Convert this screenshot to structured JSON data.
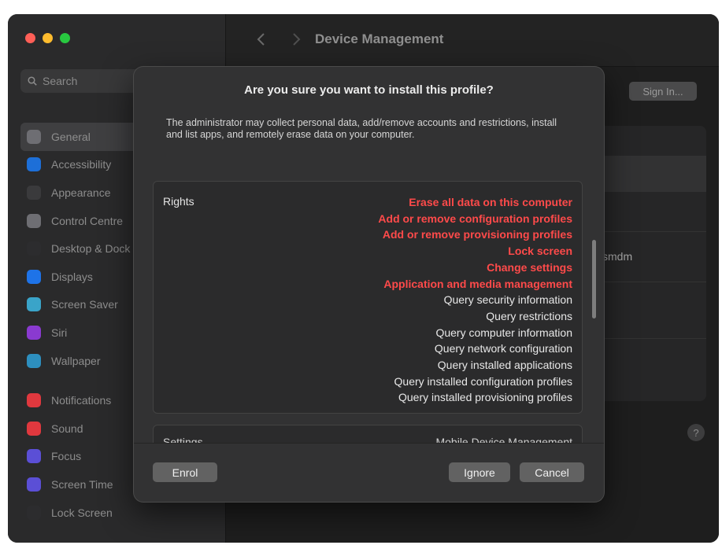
{
  "window": {
    "title": "Device Management",
    "sign_in_label": "Sign In...",
    "mdm_text": "smdm",
    "help_label": "?"
  },
  "sidebar": {
    "search_placeholder": "Search",
    "items": [
      {
        "label": "General",
        "icon": "gear-icon",
        "color": "#6e6e73",
        "active": true
      },
      {
        "label": "Accessibility",
        "icon": "accessibility-icon",
        "color": "#1d6fd8"
      },
      {
        "label": "Appearance",
        "icon": "appearance-icon",
        "color": "#3a3a3c"
      },
      {
        "label": "Control Centre",
        "icon": "control-centre-icon",
        "color": "#6e6e73"
      },
      {
        "label": "Desktop & Dock",
        "icon": "desktop-dock-icon",
        "color": "#2c2c2e"
      },
      {
        "label": "Displays",
        "icon": "displays-icon",
        "color": "#1e73e8"
      },
      {
        "label": "Screen Saver",
        "icon": "screen-saver-icon",
        "color": "#3aa4c9"
      },
      {
        "label": "Siri",
        "icon": "siri-icon",
        "color": "#8a3ad0"
      },
      {
        "label": "Wallpaper",
        "icon": "wallpaper-icon",
        "color": "#2d8fbf"
      },
      {
        "label": "Notifications",
        "icon": "notifications-icon",
        "color": "#e0383e"
      },
      {
        "label": "Sound",
        "icon": "sound-icon",
        "color": "#e0383e"
      },
      {
        "label": "Focus",
        "icon": "focus-icon",
        "color": "#5b4fd6"
      },
      {
        "label": "Screen Time",
        "icon": "screen-time-icon",
        "color": "#5b4fd6"
      },
      {
        "label": "Lock Screen",
        "icon": "lock-screen-icon",
        "color": "#2c2c2e"
      }
    ]
  },
  "dialog": {
    "title": "Are you sure you want to install this profile?",
    "message": "The administrator may collect personal data, add/remove accounts and restrictions, install and list apps, and remotely erase data on your computer.",
    "rights_label": "Rights",
    "rights": [
      {
        "text": "Erase all data on this computer",
        "danger": true
      },
      {
        "text": "Add or remove configuration profiles",
        "danger": true
      },
      {
        "text": "Add or remove provisioning profiles",
        "danger": true
      },
      {
        "text": "Lock screen",
        "danger": true
      },
      {
        "text": "Change settings",
        "danger": true
      },
      {
        "text": "Application and media management",
        "danger": true
      },
      {
        "text": "Query security information",
        "danger": false
      },
      {
        "text": "Query restrictions",
        "danger": false
      },
      {
        "text": "Query computer information",
        "danger": false
      },
      {
        "text": "Query network configuration",
        "danger": false
      },
      {
        "text": "Query installed applications",
        "danger": false
      },
      {
        "text": "Query installed configuration profiles",
        "danger": false
      },
      {
        "text": "Query installed provisioning profiles",
        "danger": false
      }
    ],
    "settings_label": "Settings",
    "settings_value": "Mobile Device Management",
    "buttons": {
      "enrol": "Enrol",
      "ignore": "Ignore",
      "cancel": "Cancel"
    },
    "colors": {
      "danger": "#ff4a4a"
    }
  }
}
